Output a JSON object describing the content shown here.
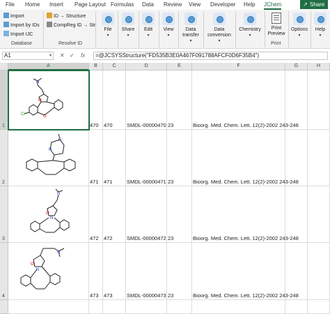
{
  "ribbon_tabs": [
    "File",
    "Home",
    "Insert",
    "Page Layout",
    "Formulas",
    "Data",
    "Review",
    "View",
    "Developer",
    "Help",
    "JChem"
  ],
  "share_label": "Share",
  "share_icon": "share-icon",
  "database_group": {
    "items": [
      "Import",
      "Import by IDs",
      "Import IJC"
    ],
    "label": "Database"
  },
  "resolve_group": {
    "items": [
      "ID → Structure",
      "CompReg ID → Str"
    ],
    "label": "Resolve ID"
  },
  "big_buttons": [
    "File",
    "Share",
    "Edit",
    "View",
    "Data transfer",
    "Data conversion",
    "Chemistry"
  ],
  "print_group": {
    "button": "Print Preview",
    "label": "Print"
  },
  "options_label": "Options",
  "help_label": "Help",
  "formula_bar": {
    "name_box": "A1",
    "cancel_symbol": "✕",
    "enter_symbol": "✓",
    "fx_symbol": "fx",
    "formula": "=@JCSYSStructure(\"FD535B3E0A467F091788AFCF0D6F35B4\")"
  },
  "columns": [
    "A",
    "B",
    "C",
    "D",
    "E",
    "F",
    "G",
    "H"
  ],
  "rows": [
    {
      "num": "1",
      "b": "470",
      "c": "470",
      "d": "SMDL-00000470",
      "e": "23",
      "f": "Bioorg. Med. Chem. Lett. 12(2)-2002 243-248"
    },
    {
      "num": "2",
      "b": "471",
      "c": "471",
      "d": "SMDL-00000471",
      "e": "23",
      "f": "Bioorg. Med. Chem. Lett. 12(2)-2002 243-248"
    },
    {
      "num": "3",
      "b": "472",
      "c": "472",
      "d": "SMDL-00000472",
      "e": "23",
      "f": "Bioorg. Med. Chem. Lett. 12(2)-2002 243-248"
    },
    {
      "num": "4",
      "b": "473",
      "c": "473",
      "d": "SMDL-00000473",
      "e": "23",
      "f": "Bioorg. Med. Chem. Lett. 12(2)-2002 243-248"
    }
  ],
  "structure_atoms": {
    "cl": "Cl",
    "o": "O",
    "n": "N"
  },
  "colors": {
    "accent": "#1f6e43",
    "oxygen": "#e00000",
    "nitrogen": "#1f3fbf",
    "chlorine": "#1a9b1a"
  }
}
